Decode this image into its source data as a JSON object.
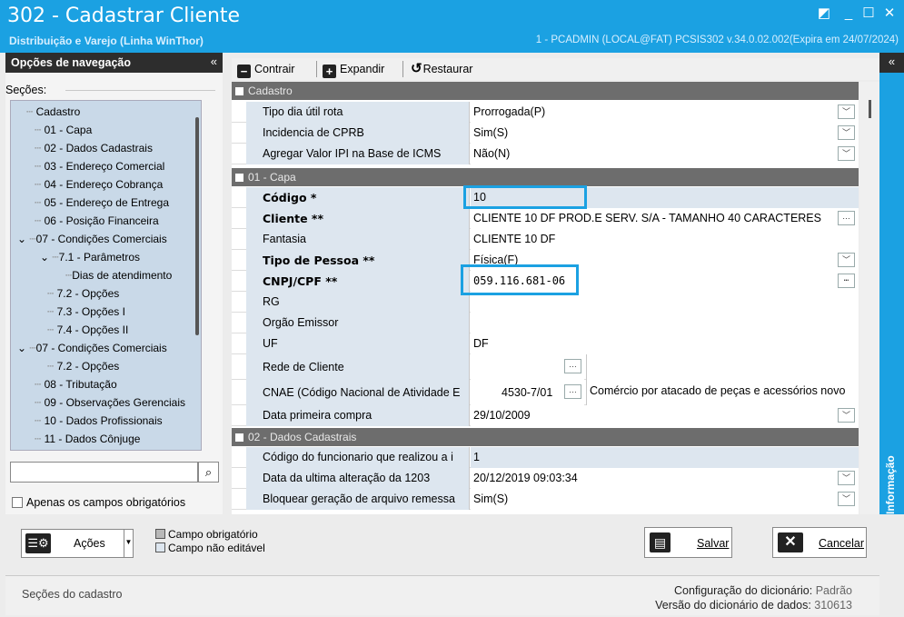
{
  "window": {
    "title": "302 - Cadastrar Cliente",
    "subtitle": "Distribuição e Varejo (Linha WinThor)",
    "info": "1 - PCADMIN (LOCAL@FAT)   PCSIS302  v.34.0.02.002(Expira em 24/07/2024)"
  },
  "nav": {
    "header": "Opções de navegação",
    "sections_label": "Seções:",
    "items": [
      {
        "label": "Cadastro"
      },
      {
        "label": "01 - Capa"
      },
      {
        "label": "02 - Dados Cadastrais"
      },
      {
        "label": "03 - Endereço Comercial"
      },
      {
        "label": "04 - Endereço Cobrança"
      },
      {
        "label": "05 - Endereço de Entrega"
      },
      {
        "label": "06 - Posição Financeira"
      },
      {
        "label": "07 - Condições Comerciais"
      },
      {
        "label": "7.1 - Parâmetros"
      },
      {
        "label": "Dias de atendimento"
      },
      {
        "label": "7.2 - Opções"
      },
      {
        "label": "7.3 - Opções I"
      },
      {
        "label": "7.4 - Opções II"
      },
      {
        "label": "07 - Condições Comerciais"
      },
      {
        "label": "7.2 - Opções"
      },
      {
        "label": "08 - Tributação"
      },
      {
        "label": "09 - Observações Gerenciais"
      },
      {
        "label": "10 - Dados Profissionais"
      },
      {
        "label": "11 - Dados Cônjuge"
      }
    ],
    "search_value": "",
    "required_only_label": "Apenas os campos obrigatórios"
  },
  "toolbar": {
    "collapse": "Contrair",
    "expand": "Expandir",
    "restore": "Restaurar"
  },
  "grid": {
    "cat_cadastro": "Cadastro",
    "cat_capa": "01 - Capa",
    "cat_dados": "02 - Dados Cadastrais",
    "rows": {
      "tipo_dia": {
        "name": "Tipo dia útil rota",
        "value": "Prorrogada(P)"
      },
      "cprb": {
        "name": "Incidencia de CPRB",
        "value": "Sim(S)"
      },
      "ipi": {
        "name": "Agregar Valor IPI na Base de ICMS",
        "value": "Não(N)"
      },
      "codigo": {
        "name": "Código *",
        "value": "10"
      },
      "cliente": {
        "name": "Cliente **",
        "value": "CLIENTE 10 DF PROD.E  SERV. S/A -  TAMANHO 40 CARACTERES"
      },
      "fantasia": {
        "name": "Fantasia",
        "value": "CLIENTE 10 DF"
      },
      "tipo_pessoa": {
        "name": "Tipo de Pessoa **",
        "value": "Física(F)"
      },
      "cnpj": {
        "name": "CNPJ/CPF **",
        "value": "059.116.681-06"
      },
      "rg": {
        "name": "RG",
        "value": ""
      },
      "orgao": {
        "name": "Orgão Emissor",
        "value": ""
      },
      "uf": {
        "name": "UF",
        "value": "DF"
      },
      "rede": {
        "name": "Rede de Cliente",
        "value": "",
        "desc": ""
      },
      "cnae": {
        "name": "CNAE (Código Nacional de Atividade E",
        "value": "4530-7/01",
        "desc": "Comércio por atacado de peças e acessórios novo"
      },
      "data_primeira": {
        "name": "Data primeira compra",
        "value": "29/10/2009"
      },
      "funcionario": {
        "name": "Código do funcionario que realizou a i",
        "value": "1"
      },
      "data_alteracao": {
        "name": "Data da ultima alteração da 1203",
        "value": "20/12/2019 09:03:34"
      },
      "bloquear": {
        "name": "Bloquear geração de arquivo remessa",
        "value": "Sim(S)"
      }
    }
  },
  "sidepanel": {
    "label": "Informação"
  },
  "footer": {
    "actions_label": "Ações",
    "legend_required": "Campo obrigatório",
    "legend_noneditable": "Campo não editável",
    "save_label": "Salvar",
    "cancel_label": "Cancelar"
  },
  "status": {
    "left": "Seções do cadastro",
    "dict_config_label": "Configuração do dicionário:",
    "dict_config_value": "Padrão",
    "dict_version_label": "Versão do dicionário de dados:",
    "dict_version_value": "310613"
  },
  "colors": {
    "accent": "#1ba1e2",
    "dark_header": "#2d2d2d",
    "category": "#6d6d6d",
    "row_label_bg": "#dde6ef",
    "tree_bg": "#c9d9e8"
  }
}
